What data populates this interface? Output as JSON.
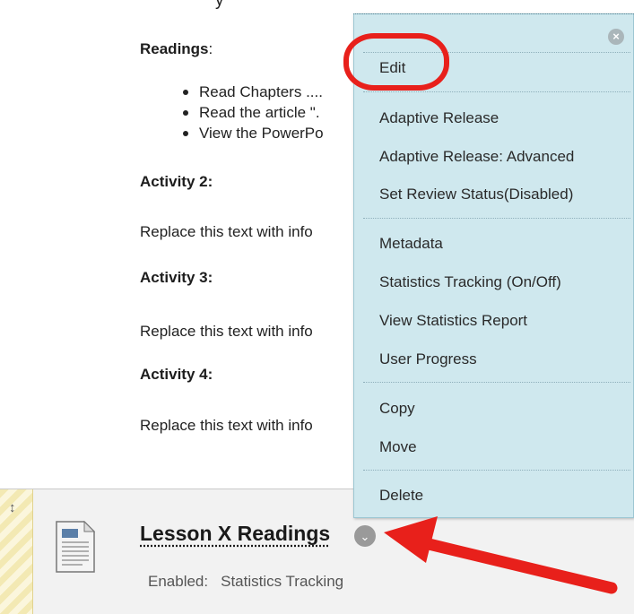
{
  "content": {
    "top_cut_text": "y",
    "readings_heading": "Readings",
    "readings_colon": ":",
    "bullets": [
      "Read Chapters ....",
      "Read the article \".",
      "View the PowerPo"
    ],
    "activity2_heading": "Activity 2:",
    "activity2_text": "Replace this text with info",
    "activity3_heading": "Activity 3:",
    "activity3_text": "Replace this text with info",
    "activity4_heading": "Activity 4:",
    "activity4_text": "Replace this text with info"
  },
  "item": {
    "title": "Lesson X Readings",
    "status_label": "Enabled:",
    "status_value": "Statistics Tracking",
    "drag_glyph": "↕",
    "chevron_glyph": "⌄",
    "icon": "document-icon"
  },
  "menu": {
    "close_glyph": "×",
    "items": [
      "Edit",
      "Adaptive Release",
      "Adaptive Release: Advanced",
      "Set Review Status(Disabled)",
      "Metadata",
      "Statistics Tracking (On/Off)",
      "View Statistics Report",
      "User Progress",
      "Copy",
      "Move",
      "Delete"
    ]
  },
  "annotations": {
    "ring_color": "#e8201b",
    "arrow_color": "#e8201b"
  },
  "colors": {
    "menu_background": "#cfe8ee",
    "drag_strip": "#f3e9b3"
  }
}
